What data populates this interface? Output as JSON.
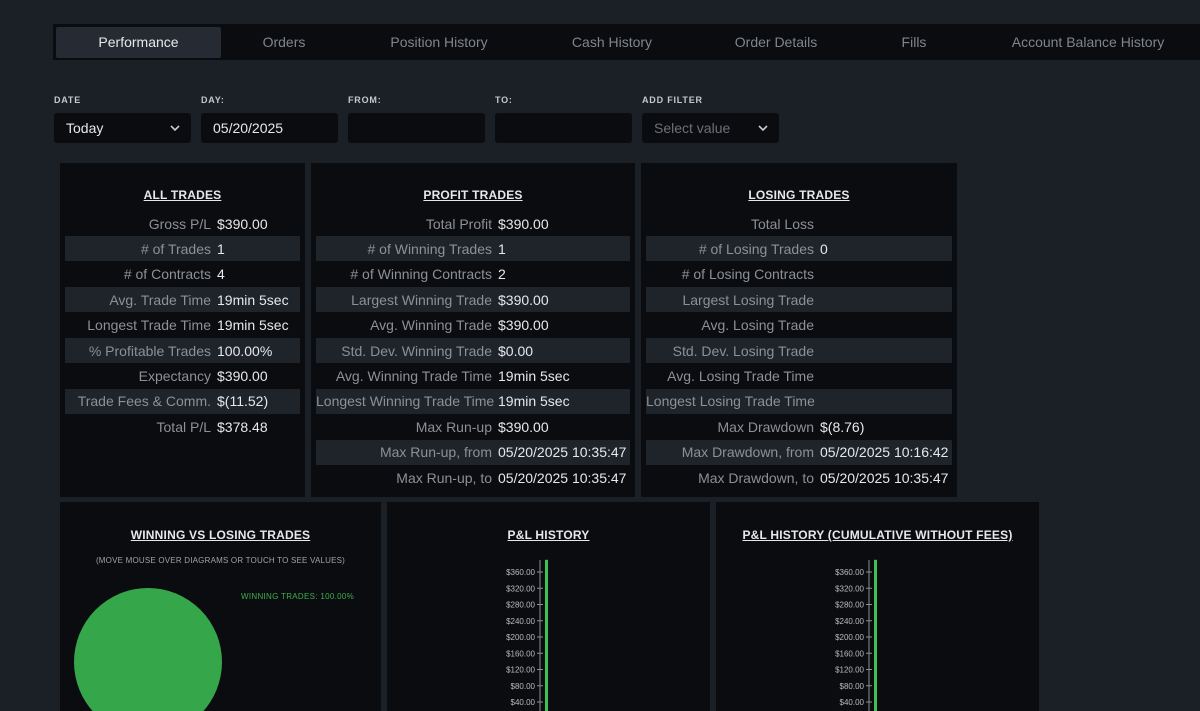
{
  "tabs": [
    {
      "label": "Performance",
      "active": true
    },
    {
      "label": "Orders"
    },
    {
      "label": "Position History"
    },
    {
      "label": "Cash History"
    },
    {
      "label": "Order Details"
    },
    {
      "label": "Fills"
    },
    {
      "label": "Account Balance History"
    }
  ],
  "filters": {
    "date": {
      "label": "DATE",
      "value": "Today"
    },
    "day": {
      "label": "DAY:",
      "value": "05/20/2025"
    },
    "from": {
      "label": "FROM:",
      "value": ""
    },
    "to": {
      "label": "TO:",
      "value": ""
    },
    "add": {
      "label": "ADD FILTER",
      "placeholder": "Select value"
    }
  },
  "all_trades": {
    "title": "ALL TRADES",
    "rows": [
      {
        "label": "Gross P/L",
        "value": "$390.00"
      },
      {
        "label": "# of Trades",
        "value": "1"
      },
      {
        "label": "# of Contracts",
        "value": "4"
      },
      {
        "label": "Avg. Trade Time",
        "value": "19min 5sec"
      },
      {
        "label": "Longest Trade Time",
        "value": "19min 5sec"
      },
      {
        "label": "% Profitable Trades",
        "value": "100.00%"
      },
      {
        "label": "Expectancy",
        "value": "$390.00"
      },
      {
        "label": "Trade Fees & Comm.",
        "value": "$(11.52)"
      },
      {
        "label": "Total P/L",
        "value": "$378.48"
      }
    ]
  },
  "profit_trades": {
    "title": "PROFIT TRADES",
    "rows": [
      {
        "label": "Total Profit",
        "value": "$390.00"
      },
      {
        "label": "# of Winning Trades",
        "value": "1"
      },
      {
        "label": "# of Winning Contracts",
        "value": "2"
      },
      {
        "label": "Largest Winning Trade",
        "value": "$390.00"
      },
      {
        "label": "Avg. Winning Trade",
        "value": "$390.00"
      },
      {
        "label": "Std. Dev. Winning Trade",
        "value": "$0.00"
      },
      {
        "label": "Avg. Winning Trade Time",
        "value": "19min 5sec"
      },
      {
        "label": "Longest Winning Trade Time",
        "value": "19min 5sec"
      },
      {
        "label": "Max Run-up",
        "value": "$390.00"
      },
      {
        "label": "Max Run-up, from",
        "value": "05/20/2025 10:35:47"
      },
      {
        "label": "Max Run-up, to",
        "value": "05/20/2025 10:35:47"
      }
    ]
  },
  "losing_trades": {
    "title": "LOSING TRADES",
    "rows": [
      {
        "label": "Total Loss",
        "value": ""
      },
      {
        "label": "# of Losing Trades",
        "value": "0"
      },
      {
        "label": "# of Losing Contracts",
        "value": ""
      },
      {
        "label": "Largest Losing Trade",
        "value": ""
      },
      {
        "label": "Avg. Losing Trade",
        "value": ""
      },
      {
        "label": "Std. Dev. Losing Trade",
        "value": ""
      },
      {
        "label": "Avg. Losing Trade Time",
        "value": ""
      },
      {
        "label": "Longest Losing Trade Time",
        "value": ""
      },
      {
        "label": "Max Drawdown",
        "value": "$(8.76)"
      },
      {
        "label": "Max Drawdown, from",
        "value": "05/20/2025 10:16:42"
      },
      {
        "label": "Max Drawdown, to",
        "value": "05/20/2025 10:35:47"
      }
    ]
  },
  "win_loss": {
    "title": "WINNING VS LOSING TRADES",
    "hint": "(MOVE MOUSE OVER DIAGRAMS OR TOUCH TO SEE VALUES)",
    "legend": "WINNING TRADES: 100.00%"
  },
  "colors": {
    "win": "#35a74a",
    "accent_line": "#3fbf55"
  },
  "chart_data": [
    {
      "type": "pie",
      "title": "WINNING VS LOSING TRADES",
      "labels": [
        "WINNING TRADES"
      ],
      "values": [
        100.0
      ]
    },
    {
      "type": "bar",
      "title": "P&L HISTORY",
      "y_ticks": [
        "$360.00",
        "$320.00",
        "$280.00",
        "$240.00",
        "$200.00",
        "$160.00",
        "$120.00",
        "$80.00",
        "$40.00"
      ],
      "series": [
        {
          "values": [
            390.0
          ]
        }
      ]
    },
    {
      "type": "bar",
      "title": "P&L HISTORY (CUMULATIVE WITHOUT FEES)",
      "y_ticks": [
        "$360.00",
        "$320.00",
        "$280.00",
        "$240.00",
        "$200.00",
        "$160.00",
        "$120.00",
        "$80.00",
        "$40.00"
      ],
      "series": [
        {
          "values": [
            390.0
          ]
        }
      ]
    }
  ]
}
